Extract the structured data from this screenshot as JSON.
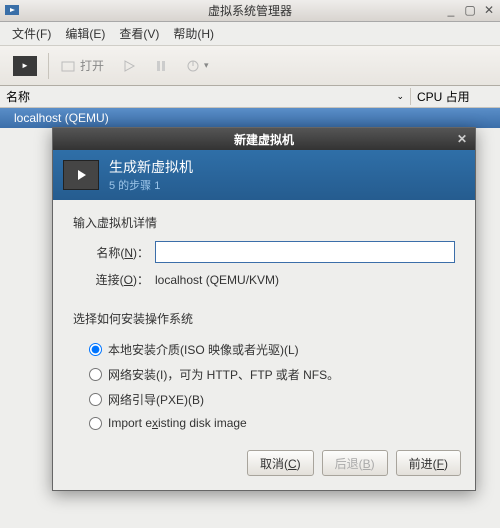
{
  "window": {
    "title": "虚拟系统管理器"
  },
  "menu": {
    "file": "文件(F)",
    "edit": "编辑(E)",
    "view": "查看(V)",
    "help": "帮助(H)"
  },
  "toolbar": {
    "open": "打开"
  },
  "columns": {
    "name": "名称",
    "cpu": "CPU 占用"
  },
  "hosts": {
    "row0": "localhost (QEMU)"
  },
  "dialog": {
    "title": "新建虚拟机",
    "header_title": "生成新虚拟机",
    "header_step": "5 的步骤 1",
    "section1": "输入虚拟机详情",
    "name_label": "名称(N)：",
    "name_value": "",
    "conn_label": "连接(O)：",
    "conn_value": "localhost (QEMU/KVM)",
    "section2": "选择如何安装操作系统",
    "opt1": "本地安装介质(ISO 映像或者光驱)(L)",
    "opt2": "网络安装(I)，可为 HTTP、FTP 或者 NFS。",
    "opt3": "网络引导(PXE)(B)",
    "opt4": "Import existing disk image",
    "btn_cancel": "取消(C)",
    "btn_back": "后退(B)",
    "btn_forward": "前进(F)"
  }
}
